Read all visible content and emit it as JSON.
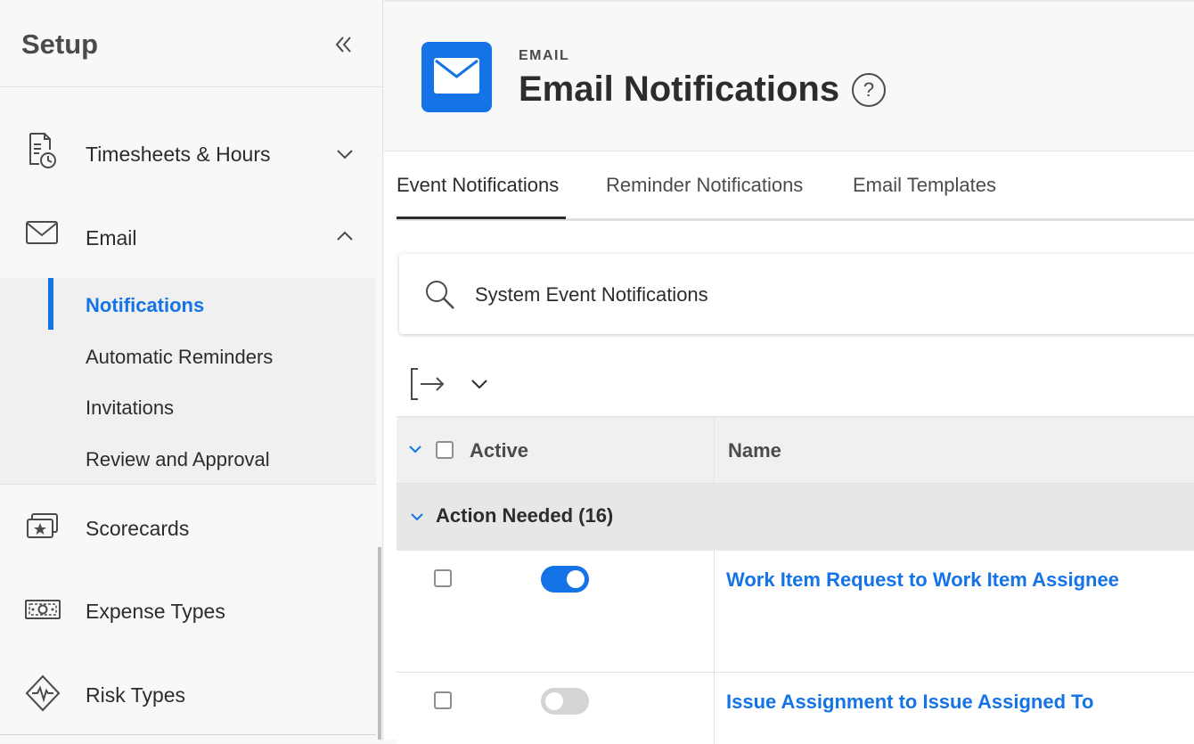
{
  "sidebar": {
    "title": "Setup",
    "sections": {
      "timesheets": {
        "label": "Timesheets & Hours",
        "icon": "timesheet-icon"
      },
      "email": {
        "label": "Email",
        "icon": "envelope-icon"
      },
      "scorecards": {
        "label": "Scorecards",
        "icon": "scorecard-icon"
      },
      "expense_types": {
        "label": "Expense Types",
        "icon": "money-icon"
      },
      "risk_types": {
        "label": "Risk Types",
        "icon": "risk-pulse-icon"
      }
    },
    "email_sub_items": [
      "Notifications",
      "Automatic Reminders",
      "Invitations",
      "Review and Approval"
    ],
    "active_sub_item": "Notifications"
  },
  "header": {
    "eyebrow": "EMAIL",
    "title": "Email Notifications",
    "help_glyph": "?"
  },
  "tabs": [
    "Event Notifications",
    "Reminder Notifications",
    "Email Templates"
  ],
  "selected_tab": "Event Notifications",
  "search": {
    "value": "System Event Notifications"
  },
  "table": {
    "columns": {
      "active": "Active",
      "name": "Name"
    },
    "group": {
      "label": "Action Needed (16)"
    },
    "rows": [
      {
        "name": "Work Item Request to Work Item Assignee",
        "active": true
      },
      {
        "name": "Issue Assignment to Issue Assigned To",
        "active": false
      }
    ]
  },
  "colors": {
    "accent": "#1473e6",
    "text": "#2c2c2c",
    "muted": "#4b4b4b"
  }
}
